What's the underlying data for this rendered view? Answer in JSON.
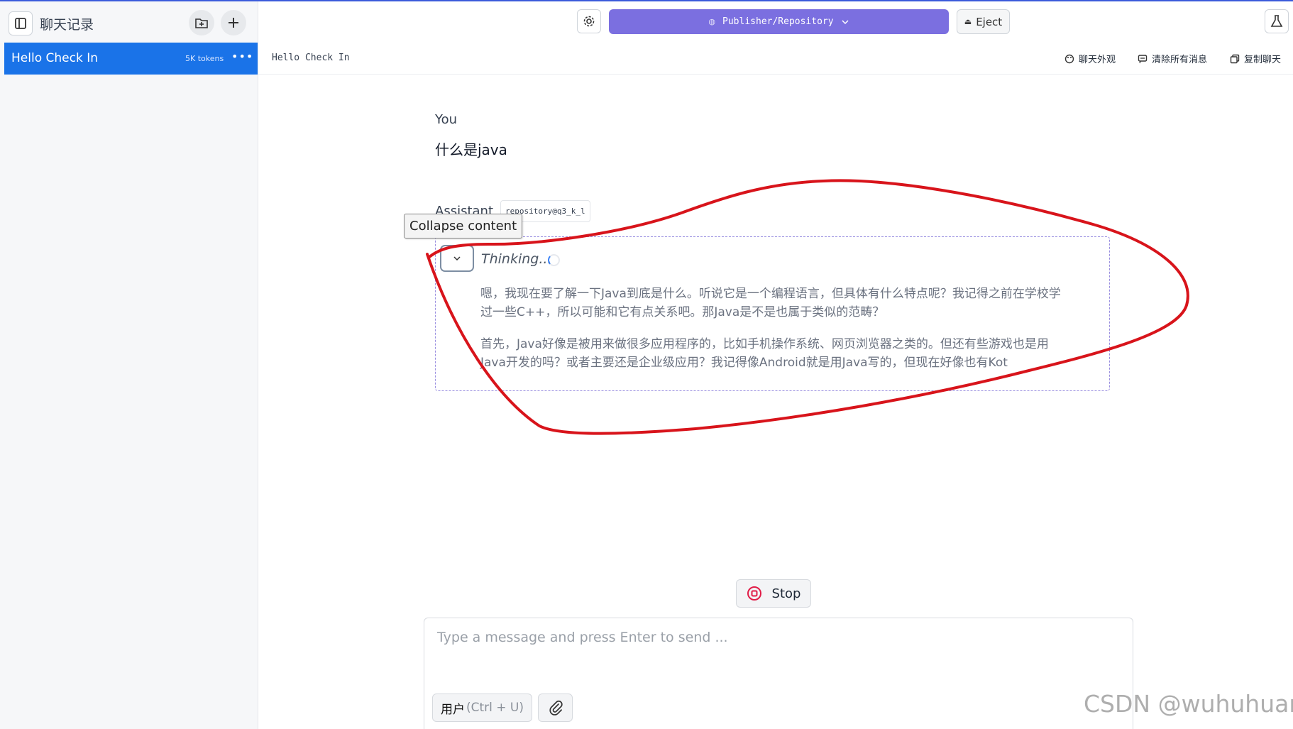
{
  "sidebar": {
    "title": "聊天记录",
    "chats": [
      {
        "label": "Hello Check In",
        "tokens": "5K tokens",
        "more": "•••"
      }
    ]
  },
  "header": {
    "model_label": "Publisher/Repository",
    "eject_label": "Eject"
  },
  "chat": {
    "title": "Hello Check In",
    "actions": [
      {
        "label": "聊天外观",
        "icon": "palette-icon"
      },
      {
        "label": "清除所有消息",
        "icon": "clear-messages-icon"
      },
      {
        "label": "复制聊天",
        "icon": "copy-icon"
      }
    ]
  },
  "messages": {
    "user": {
      "role": "You",
      "text": "什么是java"
    },
    "assistant": {
      "role": "Assistant",
      "model_tag": "repository@q3_k_l",
      "thinking_label": "Thinking...",
      "thinking_paragraphs": [
        "嗯，我现在要了解一下Java到底是什么。听说它是一个编程语言，但具体有什么特点呢？我记得之前在学校学过一些C++，所以可能和它有点关系吧。那Java是不是也属于类似的范畴？",
        "首先，Java好像是被用来做很多应用程序的，比如手机操作系统、网页浏览器之类的。但还有些游戏也是用Java开发的吗？或者主要还是企业级应用？我记得像Android就是用Java写的，但现在好像也有Kot"
      ]
    }
  },
  "tooltip": "Collapse content",
  "stop_label": "Stop",
  "input": {
    "placeholder": "Type a message and press Enter to send ...",
    "role_label": "用户",
    "role_shortcut": "(Ctrl + U)"
  },
  "watermark": "CSDN @wuhuhuan",
  "colors": {
    "accent": "#1a73e8",
    "model_button": "#7b6fe0",
    "annotation": "#d8141b",
    "stop_icon": "#e11d48"
  }
}
